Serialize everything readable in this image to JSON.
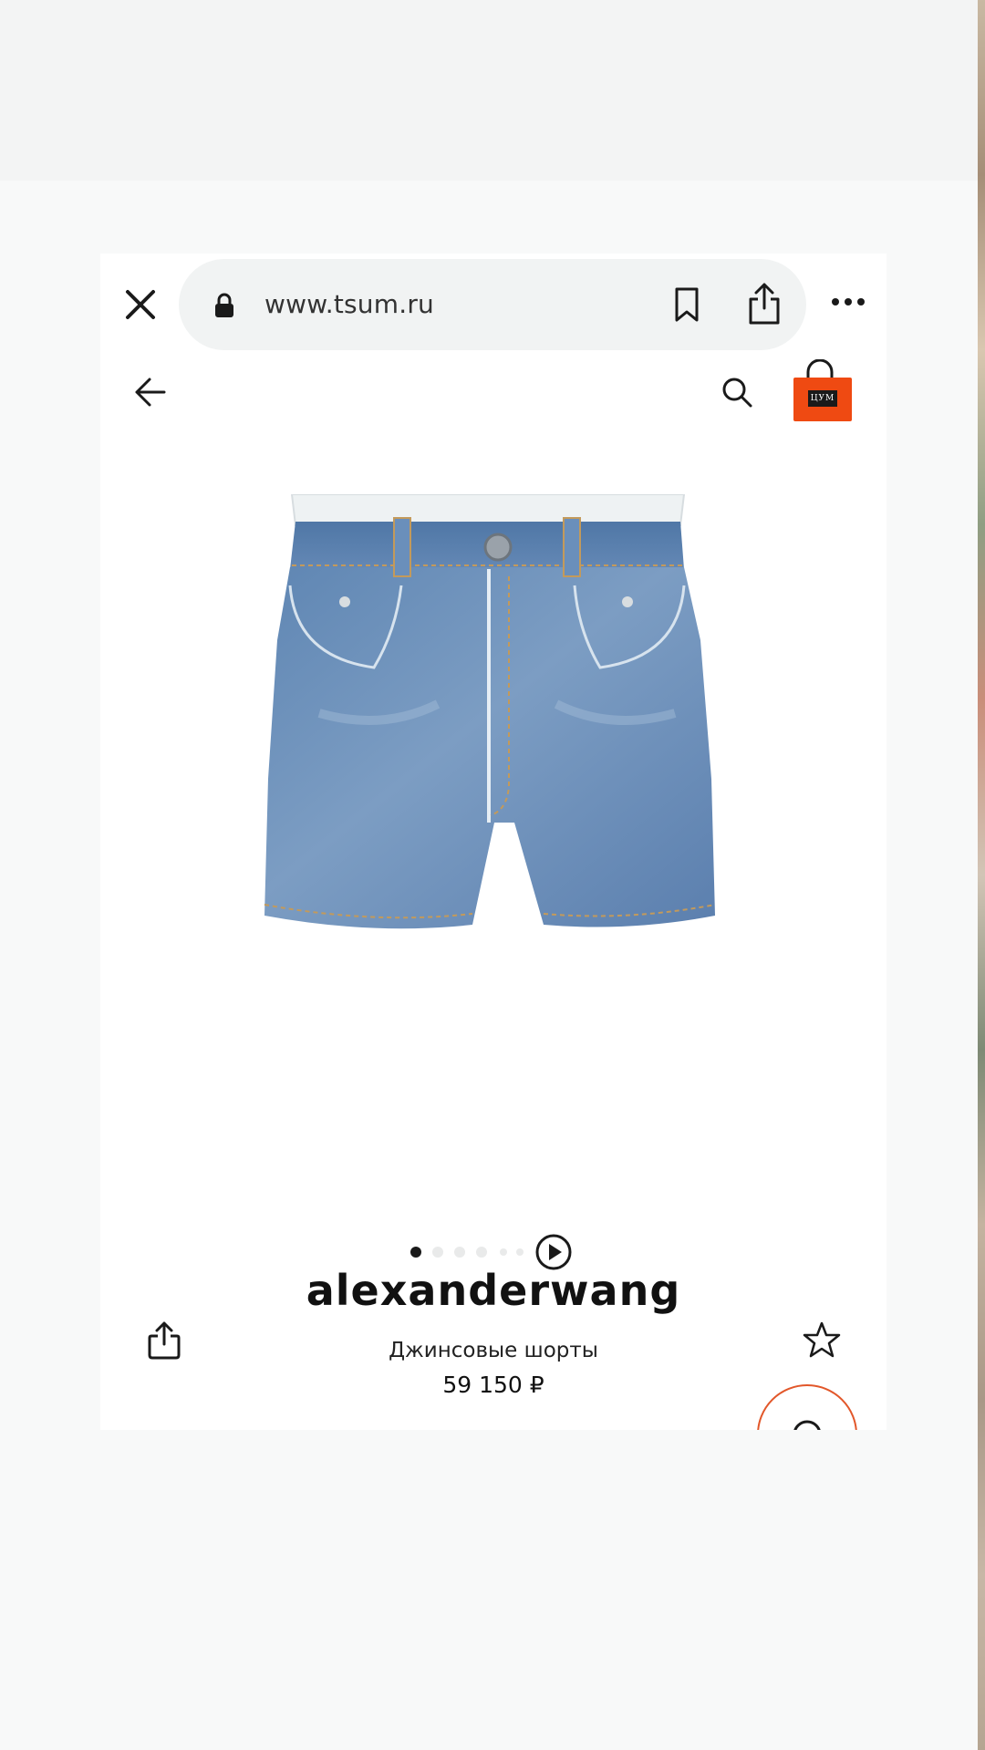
{
  "browser": {
    "url": "www.tsum.ru"
  },
  "store": {
    "logo_text": "ЦУМ"
  },
  "gallery": {
    "image_count": 6,
    "current_index": 1
  },
  "product": {
    "brand": "alexanderwang",
    "name": "Джинсовые шорты",
    "price": "59 150 ₽"
  },
  "icons": {
    "close": "close-icon",
    "lock": "lock-icon",
    "bookmark": "bookmark-icon",
    "share": "share-icon",
    "more": "more-icon",
    "back": "arrow-left-icon",
    "search": "search-icon",
    "cart": "shopping-bag-icon",
    "play": "play-icon",
    "favorite": "star-icon",
    "chat": "chat-icon"
  },
  "colors": {
    "brand_orange": "#ef4a12",
    "denim": "#6b8fb8",
    "text": "#111111"
  }
}
